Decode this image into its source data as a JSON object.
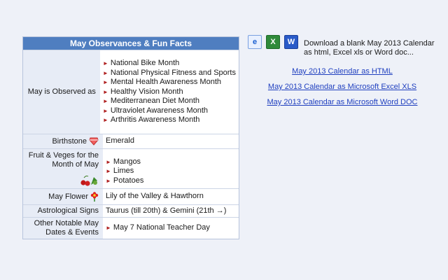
{
  "panel": {
    "title": "May Observances & Fun Facts",
    "rows": {
      "observed": {
        "label": "May is Observed as",
        "items": [
          "National Bike Month",
          "National Physical Fitness and Sports",
          "Mental Health Awareness Month",
          "Healthy Vision Month",
          "Mediterranean Diet Month",
          "Ultraviolet Awareness Month",
          "Arthritis Awareness Month"
        ]
      },
      "birthstone": {
        "label": "Birthstone",
        "value": "Emerald",
        "icon": "gem-icon"
      },
      "fruit": {
        "label_line1": "Fruit & Veges for the",
        "label_line2": "Month of May",
        "items": [
          "Mangos",
          "Limes",
          "Potatoes"
        ],
        "icon": "cherries-icon"
      },
      "flower": {
        "label": "May Flower",
        "value": "Lily of the Valley & Hawthorn",
        "icon": "flower-icon"
      },
      "astro": {
        "label": "Astrological Signs",
        "value": "Taurus (till 20th) & Gemini (21th →)"
      },
      "notable": {
        "label_line1": "Other Notable May",
        "label_line2": "Dates & Events",
        "items": [
          "May 7 National Teacher Day"
        ]
      }
    }
  },
  "downloads": {
    "icons": [
      "ie-icon",
      "excel-icon",
      "word-icon"
    ],
    "text": "Download a blank May 2013 Calendar as html, Excel xls or Word doc...",
    "links": {
      "html": "May 2013 Calendar as HTML",
      "xls": "May 2013 Calendar as Microsoft Excel XLS",
      "doc": "May 2013 Calendar as Microsoft Word DOC"
    }
  },
  "colors": {
    "header": "#4f7ec0",
    "label_bg": "#e7ecf6",
    "link": "#1f3fbf",
    "bullet": "#b02020"
  }
}
